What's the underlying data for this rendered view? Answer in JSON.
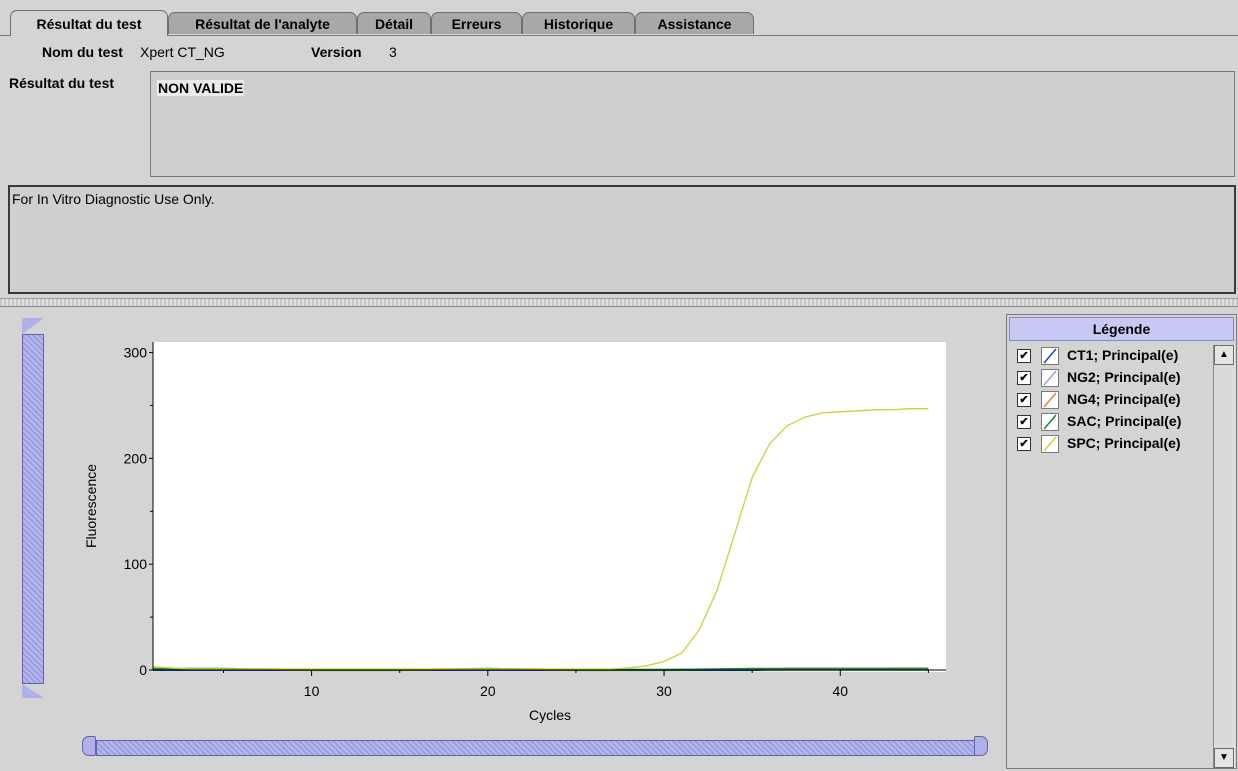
{
  "tabs": [
    {
      "label": "Résultat du test",
      "active": true
    },
    {
      "label": "Résultat de l'analyte",
      "active": false
    },
    {
      "label": "Détail",
      "active": false
    },
    {
      "label": "Erreurs",
      "active": false
    },
    {
      "label": "Historique",
      "active": false
    },
    {
      "label": "Assistance",
      "active": false
    }
  ],
  "test": {
    "name_label": "Nom du test",
    "name_value": "Xpert CT_NG",
    "version_label": "Version",
    "version_value": "3",
    "result_label": "Résultat du test",
    "result_value": "NON VALIDE"
  },
  "notice": "For In Vitro Diagnostic Use Only.",
  "legend": {
    "title": "Légende",
    "items": [
      {
        "label": "CT1; Principal(e)",
        "color": "#1f3fd6",
        "checked": true
      },
      {
        "label": "NG2; Principal(e)",
        "color": "#a9a2cf",
        "checked": true
      },
      {
        "label": "NG4; Principal(e)",
        "color": "#f07a52",
        "checked": true
      },
      {
        "label": "SAC; Principal(e)",
        "color": "#1a8a2a",
        "checked": true
      },
      {
        "label": "SPC; Principal(e)",
        "color": "#cfcf3a",
        "checked": true
      }
    ]
  },
  "chart_data": {
    "type": "line",
    "xlabel": "Cycles",
    "ylabel": "Fluorescence",
    "xlim": [
      1,
      46
    ],
    "ylim": [
      0,
      310
    ],
    "xticks": [
      10,
      20,
      30,
      40
    ],
    "yticks": [
      0,
      100,
      200,
      300
    ],
    "series": [
      {
        "name": "SPC; Principal(e)",
        "color": "#cfcf3a",
        "x": [
          1,
          2,
          3,
          5,
          10,
          15,
          20,
          25,
          27,
          28,
          29,
          30,
          31,
          32,
          33,
          34,
          35,
          36,
          37,
          38,
          39,
          40,
          41,
          42,
          43,
          44,
          45
        ],
        "y": [
          3,
          2,
          1,
          1,
          1,
          1,
          1,
          1,
          1,
          2,
          4,
          8,
          16,
          38,
          75,
          128,
          182,
          214,
          231,
          239,
          243,
          244,
          245,
          246,
          246,
          247,
          247
        ]
      },
      {
        "name": "SAC; Principal(e)",
        "color": "#1a8a2a",
        "x": [
          1,
          5,
          10,
          15,
          20,
          25,
          30,
          35,
          40,
          45
        ],
        "y": [
          1,
          1,
          0,
          0,
          1,
          0,
          0,
          1,
          1,
          1
        ]
      },
      {
        "name": "CT1; Principal(e)",
        "color": "#1f3fd6",
        "x": [
          1,
          5,
          10,
          15,
          20,
          25,
          30,
          35,
          37,
          40,
          42,
          45
        ],
        "y": [
          0,
          0,
          0,
          0,
          0,
          0,
          0,
          0,
          1,
          1,
          1,
          1
        ]
      },
      {
        "name": "NG2; Principal(e)",
        "color": "#a9a2cf",
        "x": [
          1,
          10,
          20,
          30,
          40,
          45
        ],
        "y": [
          0,
          0,
          0,
          0,
          0,
          0
        ]
      },
      {
        "name": "NG4; Principal(e)",
        "color": "#f07a52",
        "x": [
          1,
          10,
          20,
          30,
          40,
          43,
          45
        ],
        "y": [
          0,
          0,
          0,
          0,
          0,
          1,
          1
        ]
      }
    ]
  }
}
